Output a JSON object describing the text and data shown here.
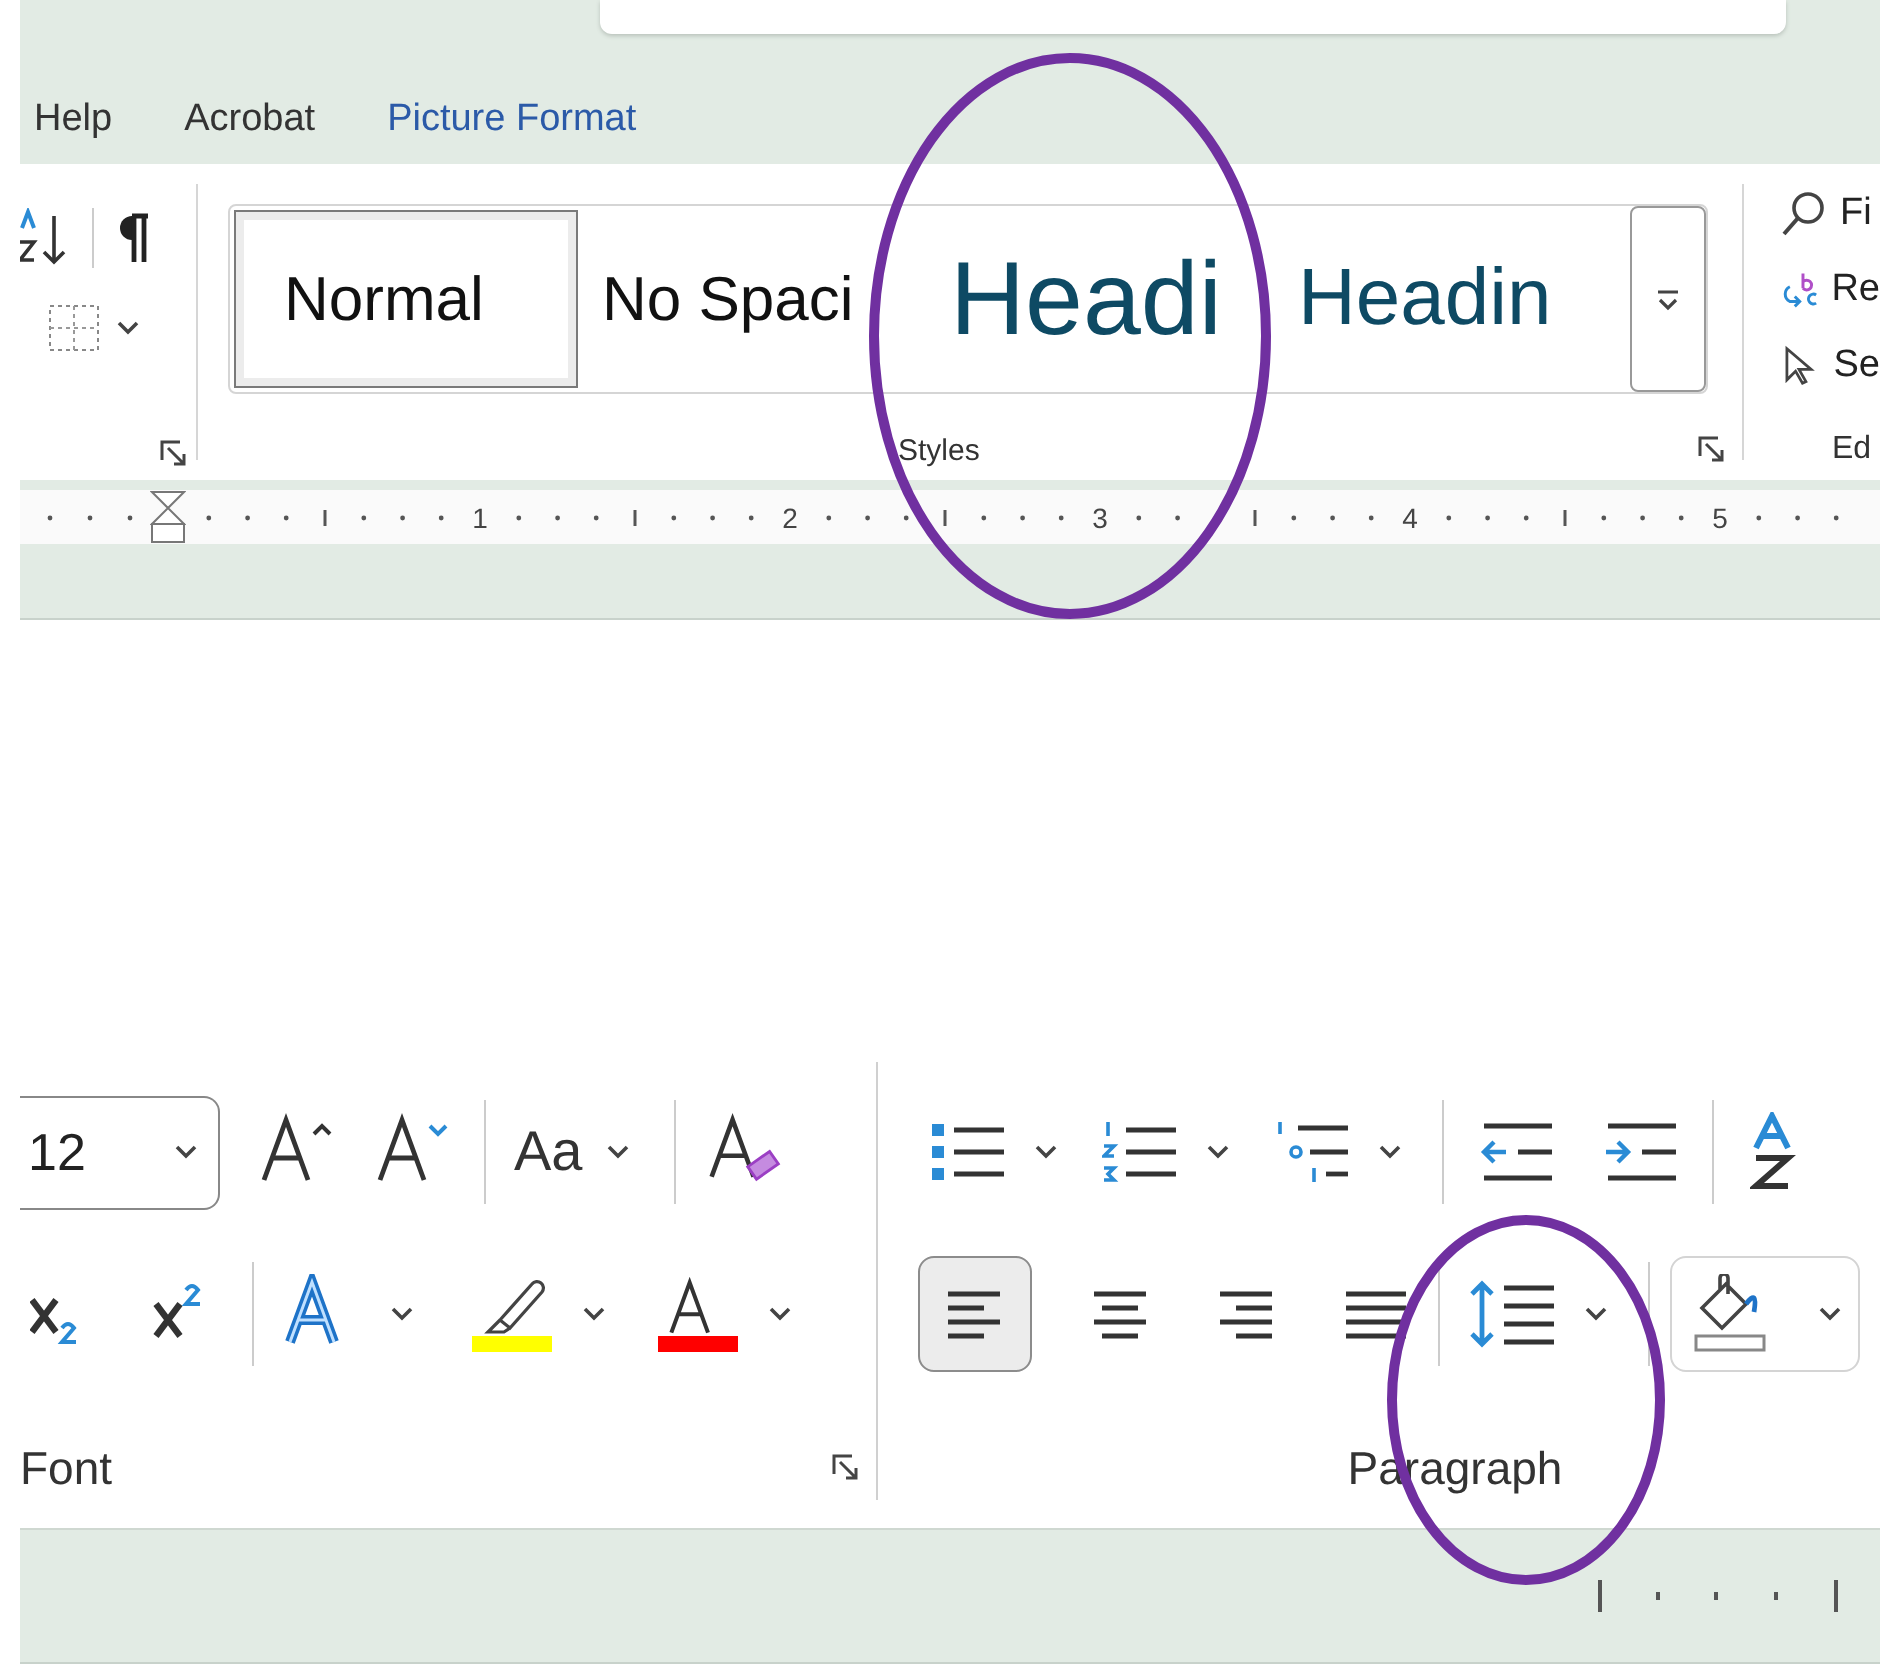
{
  "top": {
    "tabs": [
      {
        "label": "Help",
        "contextual": false
      },
      {
        "label": "Acrobat",
        "contextual": false
      },
      {
        "label": "Picture Format",
        "contextual": true
      }
    ],
    "styles": {
      "items": [
        {
          "label": "Normal",
          "kind": "body",
          "selected": true
        },
        {
          "label": "No Spaci",
          "kind": "body",
          "selected": false
        },
        {
          "label": "Headi",
          "kind": "heading1",
          "selected": false
        },
        {
          "label": "Headin",
          "kind": "heading2",
          "selected": false
        }
      ],
      "group_label": "Styles"
    },
    "editing": {
      "items": [
        {
          "label": "Fi",
          "kind": "find"
        },
        {
          "label": "Re",
          "kind": "replace"
        },
        {
          "label": "Se",
          "kind": "select"
        }
      ],
      "group_label": "Ed"
    },
    "ruler": [
      "1",
      "2",
      "3",
      "4",
      "5"
    ]
  },
  "bottom": {
    "font": {
      "size": "12",
      "change_case": "Aa",
      "group_label": "Font"
    },
    "paragraph": {
      "alignments": [
        {
          "kind": "left",
          "selected": true
        },
        {
          "kind": "center",
          "selected": false
        },
        {
          "kind": "right",
          "selected": false
        },
        {
          "kind": "justify",
          "selected": false
        }
      ],
      "group_label": "Paragraph"
    }
  }
}
